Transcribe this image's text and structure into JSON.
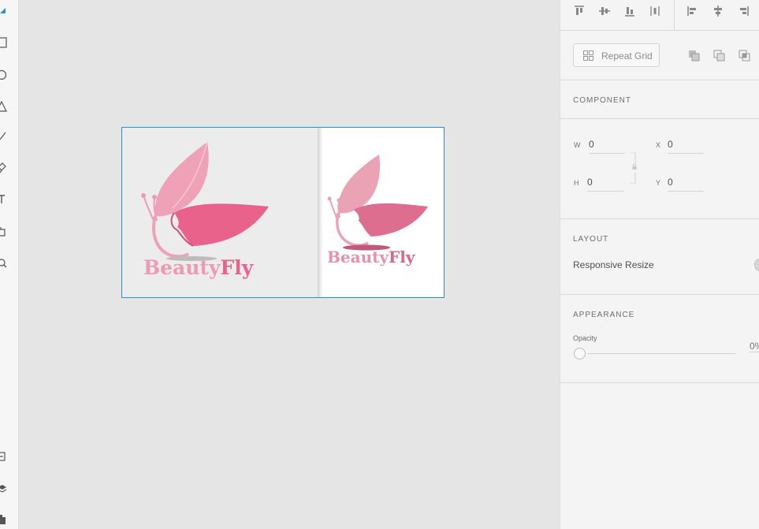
{
  "toolbar": {
    "tools": [
      "select-icon",
      "rectangle-icon",
      "ellipse-icon",
      "triangle-icon",
      "line-icon",
      "pen-icon",
      "text-icon",
      "artboard-icon",
      "zoom-icon"
    ],
    "bottom_tools": [
      "assets-icon",
      "layers-icon",
      "plugins-icon"
    ]
  },
  "artboard": {
    "left_image": {
      "brand_a": "Beauty",
      "brand_b": "Fly"
    },
    "right_image": {
      "brand_a": "Beauty",
      "brand_b": "Fly"
    }
  },
  "panel": {
    "repeat_grid_label": "Repeat Grid",
    "component_title": "COMPONENT",
    "transform": {
      "w_label": "W",
      "w_value": "0",
      "x_label": "X",
      "x_value": "0",
      "h_label": "H",
      "h_value": "0",
      "y_label": "Y",
      "y_value": "0"
    },
    "layout_title": "LAYOUT",
    "responsive_resize_label": "Responsive Resize",
    "appearance_title": "APPEARANCE",
    "opacity_label": "Opacity",
    "opacity_value": "0%"
  },
  "colors": {
    "selection": "#2a8fd6",
    "brand_pink": "#e8628b",
    "brand_light_pink": "#ef9ab3"
  }
}
